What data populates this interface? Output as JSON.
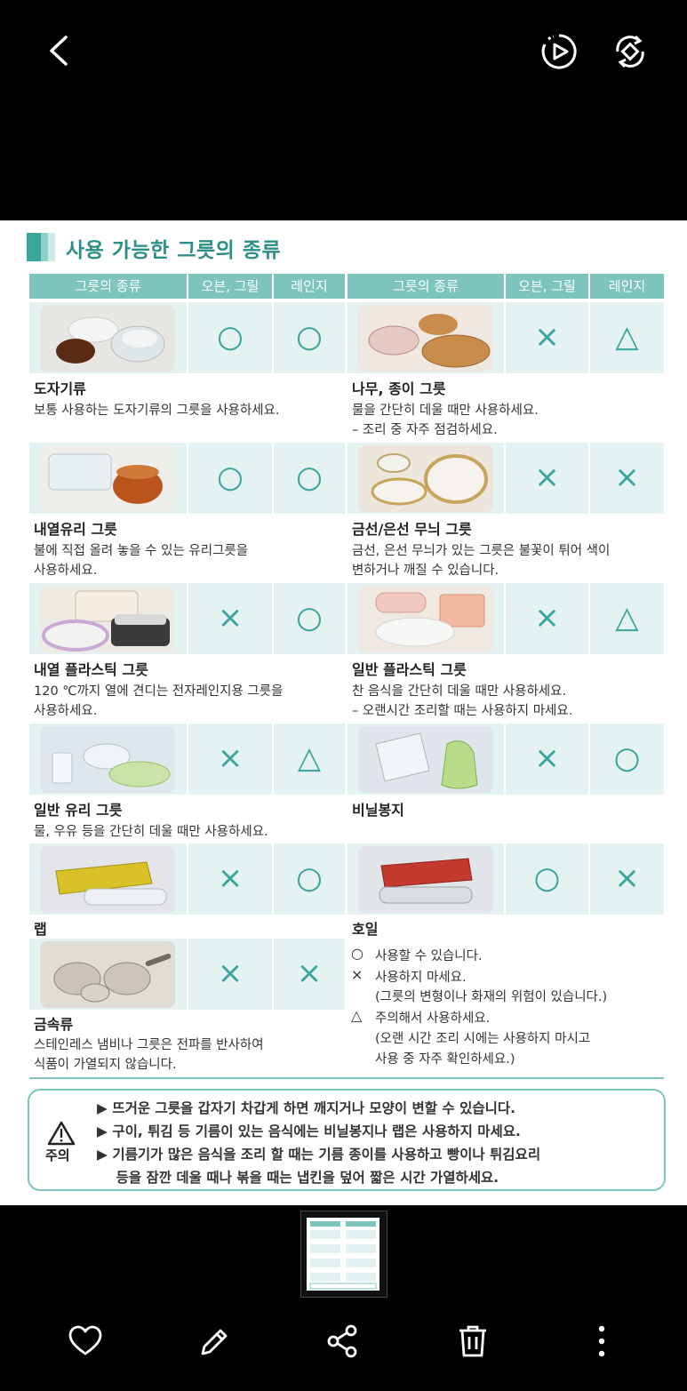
{
  "app": {
    "top_icons": [
      "back-arrow-icon",
      "motion-photo-play-icon",
      "auto-rotate-icon"
    ],
    "bottom_icons": [
      "heart-icon",
      "edit-pencil-icon",
      "share-icon",
      "trash-icon",
      "more-vertical-icon"
    ]
  },
  "document": {
    "title": "사용 가능한 그릇의 종류",
    "headers": [
      "그릇의 종류",
      "오븐, 그릴",
      "레인지",
      "그릇의 종류",
      "오븐, 그릴",
      "레인지"
    ],
    "left_items": [
      {
        "name": "도자기류",
        "oven": "○",
        "range": "○",
        "desc": "보통 사용하는 도자기류의 그릇을 사용하세요."
      },
      {
        "name": "내열유리 그릇",
        "oven": "○",
        "range": "○",
        "desc": "불에 직접 올려 놓을 수 있는 유리그릇을\n사용하세요."
      },
      {
        "name": "내열 플라스틱 그릇",
        "oven": "×",
        "range": "○",
        "desc": "120 ℃까지 열에 견디는 전자레인지용 그릇을\n사용하세요."
      },
      {
        "name": "일반 유리 그릇",
        "oven": "×",
        "range": "△",
        "desc": "물, 우유 등을 간단히 데울 때만 사용하세요."
      },
      {
        "name": "랩",
        "oven": "×",
        "range": "○",
        "desc": ""
      },
      {
        "name": "금속류",
        "oven": "×",
        "range": "×",
        "desc": "스테인레스 냄비나 그릇은 전파를 반사하여\n식품이 가열되지 않습니다."
      }
    ],
    "right_items": [
      {
        "name": "나무, 종이 그릇",
        "oven": "×",
        "range": "△",
        "desc": "물을 간단히 데울 때만 사용하세요.\n– 조리 중 자주 점검하세요."
      },
      {
        "name": "금선/은선 무늬 그릇",
        "oven": "×",
        "range": "×",
        "desc": "금선, 은선 무늬가 있는 그릇은 불꽃이 튀어 색이\n변하거나 깨질 수 있습니다."
      },
      {
        "name": "일반 플라스틱 그릇",
        "oven": "×",
        "range": "△",
        "desc": "찬 음식을 간단히 데울 때만 사용하세요.\n– 오랜시간 조리할 때는 사용하지 마세요."
      },
      {
        "name": "비닐봉지",
        "oven": "×",
        "range": "○",
        "desc": ""
      },
      {
        "name": "호일",
        "oven": "○",
        "range": "×",
        "desc": ""
      }
    ],
    "legend": [
      {
        "symbol": "○",
        "text": "사용할 수 있습니다."
      },
      {
        "symbol": "×",
        "text": "사용하지 마세요."
      },
      {
        "symbol": "",
        "text": "(그릇의 변형이나 화재의 위험이 있습니다.)"
      },
      {
        "symbol": "△",
        "text": "주의해서 사용하세요."
      },
      {
        "symbol": "",
        "text": "(오랜 시간 조리 시에는 사용하지 마시고"
      },
      {
        "symbol": "",
        "text": "사용 중 자주 확인하세요.)"
      }
    ],
    "caution_label": "주의",
    "cautions": [
      "▶ 뜨거운 그릇을 갑자기 차갑게 하면 깨지거나 모양이 변할 수 있습니다.",
      "▶ 구이, 튀김 등 기름이 있는 음식에는 비닐봉지나 랩은 사용하지 마세요.",
      "▶ 기름기가 많은 음식을 조리 할 때는 기름 종이를 사용하고 빵이나 튀김요리",
      "    등을 잠깐 데울 때나 볶을 때는 냅킨을 덮어 짧은 시간 가열하세요."
    ],
    "colors": {
      "accent": "#3aa59a",
      "header": "#7cc4bc",
      "cell": "#e4f3f1",
      "title": "#2c8f86"
    }
  }
}
